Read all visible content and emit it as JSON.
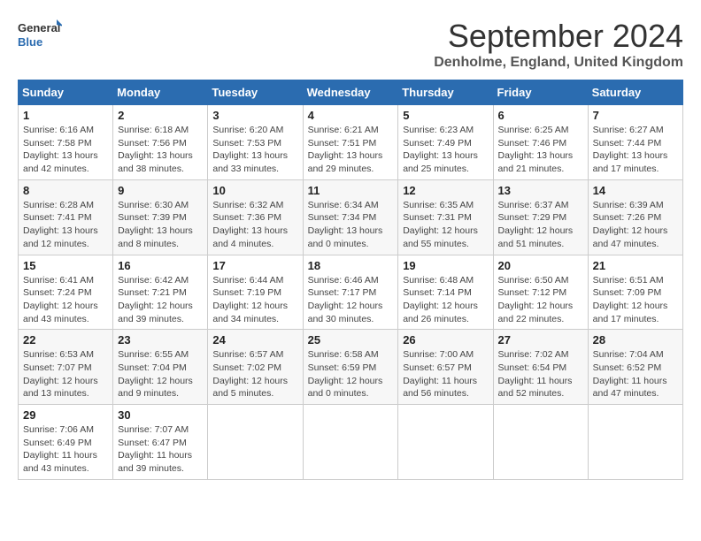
{
  "header": {
    "logo_line1": "General",
    "logo_line2": "Blue",
    "title": "September 2024",
    "subtitle": "Denholme, England, United Kingdom"
  },
  "weekdays": [
    "Sunday",
    "Monday",
    "Tuesday",
    "Wednesday",
    "Thursday",
    "Friday",
    "Saturday"
  ],
  "weeks": [
    [
      {
        "day": "1",
        "sunrise": "6:16 AM",
        "sunset": "7:58 PM",
        "daylight": "13 hours and 42 minutes."
      },
      {
        "day": "2",
        "sunrise": "6:18 AM",
        "sunset": "7:56 PM",
        "daylight": "13 hours and 38 minutes."
      },
      {
        "day": "3",
        "sunrise": "6:20 AM",
        "sunset": "7:53 PM",
        "daylight": "13 hours and 33 minutes."
      },
      {
        "day": "4",
        "sunrise": "6:21 AM",
        "sunset": "7:51 PM",
        "daylight": "13 hours and 29 minutes."
      },
      {
        "day": "5",
        "sunrise": "6:23 AM",
        "sunset": "7:49 PM",
        "daylight": "13 hours and 25 minutes."
      },
      {
        "day": "6",
        "sunrise": "6:25 AM",
        "sunset": "7:46 PM",
        "daylight": "13 hours and 21 minutes."
      },
      {
        "day": "7",
        "sunrise": "6:27 AM",
        "sunset": "7:44 PM",
        "daylight": "13 hours and 17 minutes."
      }
    ],
    [
      {
        "day": "8",
        "sunrise": "6:28 AM",
        "sunset": "7:41 PM",
        "daylight": "13 hours and 12 minutes."
      },
      {
        "day": "9",
        "sunrise": "6:30 AM",
        "sunset": "7:39 PM",
        "daylight": "13 hours and 8 minutes."
      },
      {
        "day": "10",
        "sunrise": "6:32 AM",
        "sunset": "7:36 PM",
        "daylight": "13 hours and 4 minutes."
      },
      {
        "day": "11",
        "sunrise": "6:34 AM",
        "sunset": "7:34 PM",
        "daylight": "13 hours and 0 minutes."
      },
      {
        "day": "12",
        "sunrise": "6:35 AM",
        "sunset": "7:31 PM",
        "daylight": "12 hours and 55 minutes."
      },
      {
        "day": "13",
        "sunrise": "6:37 AM",
        "sunset": "7:29 PM",
        "daylight": "12 hours and 51 minutes."
      },
      {
        "day": "14",
        "sunrise": "6:39 AM",
        "sunset": "7:26 PM",
        "daylight": "12 hours and 47 minutes."
      }
    ],
    [
      {
        "day": "15",
        "sunrise": "6:41 AM",
        "sunset": "7:24 PM",
        "daylight": "12 hours and 43 minutes."
      },
      {
        "day": "16",
        "sunrise": "6:42 AM",
        "sunset": "7:21 PM",
        "daylight": "12 hours and 39 minutes."
      },
      {
        "day": "17",
        "sunrise": "6:44 AM",
        "sunset": "7:19 PM",
        "daylight": "12 hours and 34 minutes."
      },
      {
        "day": "18",
        "sunrise": "6:46 AM",
        "sunset": "7:17 PM",
        "daylight": "12 hours and 30 minutes."
      },
      {
        "day": "19",
        "sunrise": "6:48 AM",
        "sunset": "7:14 PM",
        "daylight": "12 hours and 26 minutes."
      },
      {
        "day": "20",
        "sunrise": "6:50 AM",
        "sunset": "7:12 PM",
        "daylight": "12 hours and 22 minutes."
      },
      {
        "day": "21",
        "sunrise": "6:51 AM",
        "sunset": "7:09 PM",
        "daylight": "12 hours and 17 minutes."
      }
    ],
    [
      {
        "day": "22",
        "sunrise": "6:53 AM",
        "sunset": "7:07 PM",
        "daylight": "12 hours and 13 minutes."
      },
      {
        "day": "23",
        "sunrise": "6:55 AM",
        "sunset": "7:04 PM",
        "daylight": "12 hours and 9 minutes."
      },
      {
        "day": "24",
        "sunrise": "6:57 AM",
        "sunset": "7:02 PM",
        "daylight": "12 hours and 5 minutes."
      },
      {
        "day": "25",
        "sunrise": "6:58 AM",
        "sunset": "6:59 PM",
        "daylight": "12 hours and 0 minutes."
      },
      {
        "day": "26",
        "sunrise": "7:00 AM",
        "sunset": "6:57 PM",
        "daylight": "11 hours and 56 minutes."
      },
      {
        "day": "27",
        "sunrise": "7:02 AM",
        "sunset": "6:54 PM",
        "daylight": "11 hours and 52 minutes."
      },
      {
        "day": "28",
        "sunrise": "7:04 AM",
        "sunset": "6:52 PM",
        "daylight": "11 hours and 47 minutes."
      }
    ],
    [
      {
        "day": "29",
        "sunrise": "7:06 AM",
        "sunset": "6:49 PM",
        "daylight": "11 hours and 43 minutes."
      },
      {
        "day": "30",
        "sunrise": "7:07 AM",
        "sunset": "6:47 PM",
        "daylight": "11 hours and 39 minutes."
      },
      null,
      null,
      null,
      null,
      null
    ]
  ]
}
